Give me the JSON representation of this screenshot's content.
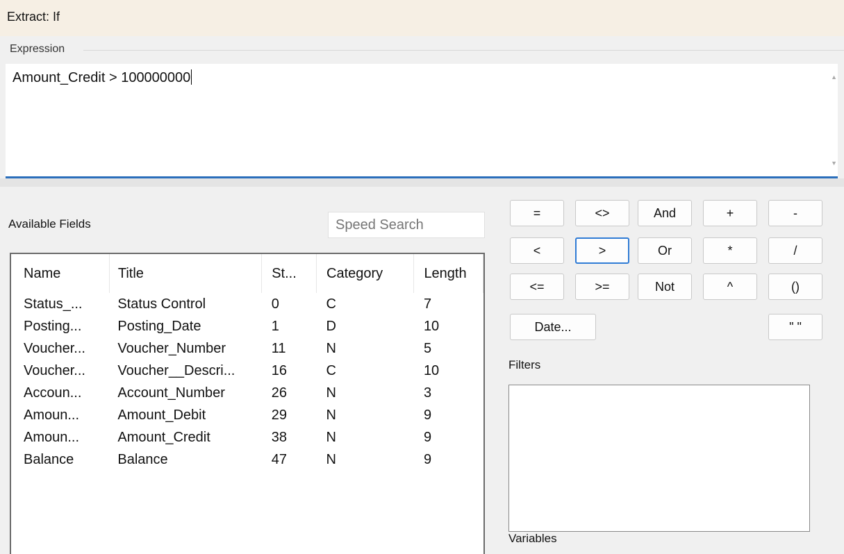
{
  "window": {
    "title": "Extract: If"
  },
  "expression": {
    "label": "Expression",
    "value": "Amount_Credit > 100000000"
  },
  "available_fields": {
    "label": "Available Fields",
    "search_placeholder": "Speed Search",
    "columns": [
      "Name",
      "Title",
      "St...",
      "Category",
      "Length"
    ],
    "rows": [
      [
        "Status_...",
        "Status Control",
        "0",
        "C",
        "7"
      ],
      [
        "Posting...",
        "Posting_Date",
        "1",
        "D",
        "10"
      ],
      [
        "Voucher...",
        "Voucher_Number",
        "11",
        "N",
        "5"
      ],
      [
        "Voucher...",
        "Voucher__Descri...",
        "16",
        "C",
        "10"
      ],
      [
        "Accoun...",
        "Account_Number",
        "26",
        "N",
        "3"
      ],
      [
        "Amoun...",
        "Amount_Debit",
        "29",
        "N",
        "9"
      ],
      [
        "Amoun...",
        "Amount_Credit",
        "38",
        "N",
        "9"
      ],
      [
        "Balance",
        "Balance",
        "47",
        "N",
        "9"
      ]
    ]
  },
  "operators": {
    "eq": "=",
    "ne": "<>",
    "and": "And",
    "plus": "+",
    "minus": "-",
    "lt": "<",
    "gt": ">",
    "or": "Or",
    "mul": "*",
    "div": "/",
    "le": "<=",
    "ge": ">=",
    "not": "Not",
    "pow": "^",
    "paren": "()",
    "date": "Date...",
    "quote": "\" \""
  },
  "filters": {
    "label": "Filters"
  },
  "variables": {
    "label": "Variables"
  },
  "colors": {
    "accent": "#2a6ebb",
    "selected_border": "#2f7bd5",
    "title_bg": "#f6efe4"
  }
}
